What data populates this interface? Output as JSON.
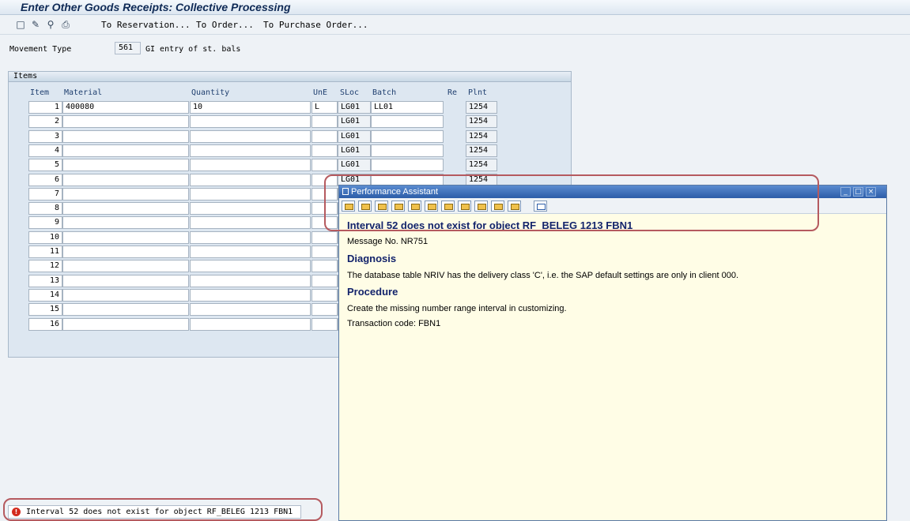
{
  "window": {
    "title": "Enter Other Goods Receipts: Collective Processing"
  },
  "toolbar": {
    "icons": [
      "new-document-icon",
      "edit-pencil-icon",
      "find-icon",
      "print-icon"
    ],
    "links": [
      "To Reservation...",
      "To Order...",
      "To Purchase Order..."
    ]
  },
  "movement": {
    "label": "Movement Type",
    "code": "561",
    "description": "GI entry of st. bals"
  },
  "items": {
    "title": "Items",
    "columns": [
      "Item",
      "Material",
      "Quantity",
      "UnE",
      "SLoc",
      "Batch",
      "Re",
      "Plnt"
    ],
    "rows": [
      {
        "item": "1",
        "material": "400080",
        "quantity": "10",
        "une": "L",
        "sloc": "LG01",
        "batch": "LL01",
        "plnt": "1254"
      },
      {
        "item": "2",
        "material": "",
        "quantity": "",
        "une": "",
        "sloc": "LG01",
        "batch": "",
        "plnt": "1254"
      },
      {
        "item": "3",
        "material": "",
        "quantity": "",
        "une": "",
        "sloc": "LG01",
        "batch": "",
        "plnt": "1254"
      },
      {
        "item": "4",
        "material": "",
        "quantity": "",
        "une": "",
        "sloc": "LG01",
        "batch": "",
        "plnt": "1254"
      },
      {
        "item": "5",
        "material": "",
        "quantity": "",
        "une": "",
        "sloc": "LG01",
        "batch": "",
        "plnt": "1254"
      },
      {
        "item": "6",
        "material": "",
        "quantity": "",
        "une": "",
        "sloc": "LG01",
        "batch": "",
        "plnt": "1254"
      },
      {
        "item": "7",
        "material": "",
        "quantity": "",
        "une": "",
        "sloc": "",
        "batch": "",
        "plnt": ""
      },
      {
        "item": "8",
        "material": "",
        "quantity": "",
        "une": "",
        "sloc": "",
        "batch": "",
        "plnt": ""
      },
      {
        "item": "9",
        "material": "",
        "quantity": "",
        "une": "",
        "sloc": "",
        "batch": "",
        "plnt": ""
      },
      {
        "item": "10",
        "material": "",
        "quantity": "",
        "une": "",
        "sloc": "",
        "batch": "",
        "plnt": ""
      },
      {
        "item": "11",
        "material": "",
        "quantity": "",
        "une": "",
        "sloc": "",
        "batch": "",
        "plnt": ""
      },
      {
        "item": "12",
        "material": "",
        "quantity": "",
        "une": "",
        "sloc": "",
        "batch": "",
        "plnt": ""
      },
      {
        "item": "13",
        "material": "",
        "quantity": "",
        "une": "",
        "sloc": "",
        "batch": "",
        "plnt": ""
      },
      {
        "item": "14",
        "material": "",
        "quantity": "",
        "une": "",
        "sloc": "",
        "batch": "",
        "plnt": ""
      },
      {
        "item": "15",
        "material": "",
        "quantity": "",
        "une": "",
        "sloc": "",
        "batch": "",
        "plnt": ""
      },
      {
        "item": "16",
        "material": "",
        "quantity": "",
        "une": "",
        "sloc": "",
        "batch": "",
        "plnt": ""
      }
    ]
  },
  "popup": {
    "title": "Performance Assistant",
    "tool_icons": [
      "back-icon",
      "forward-icon",
      "home-icon",
      "tree-icon",
      "search-icon",
      "highlight-icon",
      "print-icon",
      "book-icon",
      "docs-icon",
      "info-icon",
      "save-icon",
      "close-icon"
    ],
    "heading": "Interval 52 does not exist for object RF_BELEG 1213 FBN1",
    "message_no": "Message No. NR751",
    "diagnosis_title": "Diagnosis",
    "diagnosis_text": "The database table NRIV has the delivery class 'C', i.e. the SAP default settings are only in client 000.",
    "procedure_title": "Procedure",
    "procedure_text": "Create the missing number range interval in customizing.",
    "transaction": "Transaction code: FBN1"
  },
  "status": {
    "message": "Interval 52 does not exist for object RF_BELEG 1213 FBN1",
    "icon": "error-icon",
    "color": "#d32b1e"
  }
}
